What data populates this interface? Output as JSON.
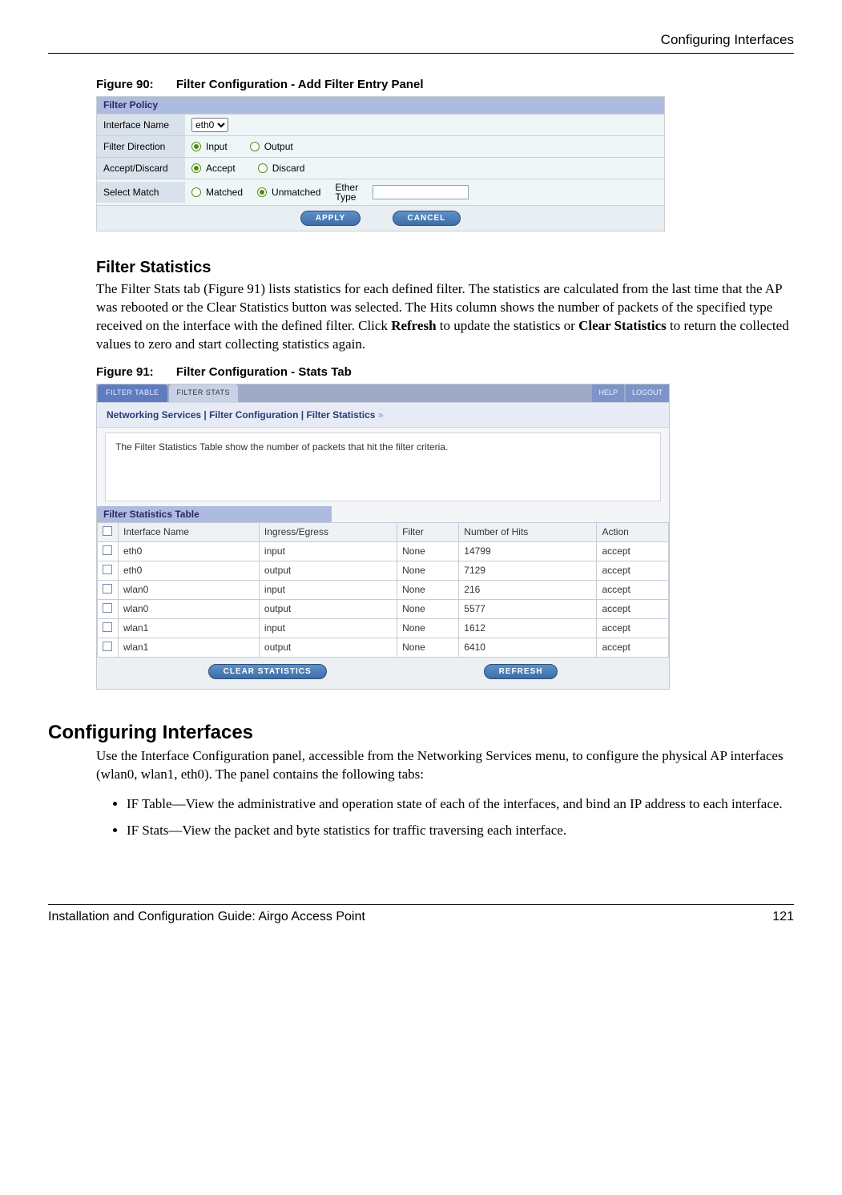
{
  "header": {
    "right": "Configuring Interfaces"
  },
  "figure90": {
    "caption_no": "Figure 90:",
    "caption_text": "Filter Configuration - Add Filter Entry Panel",
    "panel_title": "Filter Policy",
    "rows": {
      "interface_label": "Interface Name",
      "interface_value": "eth0",
      "direction_label": "Filter Direction",
      "direction_options": {
        "input": "Input",
        "output": "Output"
      },
      "accept_label": "Accept/Discard",
      "accept_options": {
        "accept": "Accept",
        "discard": "Discard"
      },
      "match_label": "Select Match",
      "match_options": {
        "matched": "Matched",
        "unmatched": "Unmatched"
      },
      "ether_label_1": "Ether",
      "ether_label_2": "Type"
    },
    "buttons": {
      "apply": "APPLY",
      "cancel": "CANCEL"
    }
  },
  "section_filter_stats": {
    "heading": "Filter Statistics",
    "body_pre": "The Filter Stats tab (Figure 91) lists statistics for each defined filter. The statistics are calculated from the last time that the AP was rebooted or the Clear Statistics button was selected. The Hits column shows the number of packets of the specified type received on the interface with the defined filter. Click ",
    "bold1": "Refresh",
    "body_mid": " to update the statistics or ",
    "bold2": "Clear Statistics",
    "body_post": " to return the collected values to zero and start collecting statistics again."
  },
  "figure91": {
    "caption_no": "Figure 91:",
    "caption_text": "Filter Configuration - Stats Tab",
    "tabs": {
      "filter_table": "FILTER TABLE",
      "filter_stats": "FILTER STATS",
      "help": "HELP",
      "logout": "LOGOUT"
    },
    "breadcrumb": {
      "a": "Networking Services",
      "b": "Filter Configuration",
      "c": "Filter Statistics"
    },
    "desc": "The Filter Statistics Table show the number of packets that hit the filter criteria.",
    "stats_title": "Filter Statistics Table",
    "columns": {
      "c1": "Interface Name",
      "c2": "Ingress/Egress",
      "c3": "Filter",
      "c4": "Number of Hits",
      "c5": "Action"
    },
    "rows": [
      {
        "iface": "eth0",
        "dir": "input",
        "filter": "None",
        "hits": "14799",
        "action": "accept"
      },
      {
        "iface": "eth0",
        "dir": "output",
        "filter": "None",
        "hits": "7129",
        "action": "accept"
      },
      {
        "iface": "wlan0",
        "dir": "input",
        "filter": "None",
        "hits": "216",
        "action": "accept"
      },
      {
        "iface": "wlan0",
        "dir": "output",
        "filter": "None",
        "hits": "5577",
        "action": "accept"
      },
      {
        "iface": "wlan1",
        "dir": "input",
        "filter": "None",
        "hits": "1612",
        "action": "accept"
      },
      {
        "iface": "wlan1",
        "dir": "output",
        "filter": "None",
        "hits": "6410",
        "action": "accept"
      }
    ],
    "buttons": {
      "clear": "CLEAR STATISTICS",
      "refresh": "REFRESH"
    }
  },
  "section_conf_if": {
    "heading": "Configuring Interfaces",
    "body": "Use the Interface Configuration panel, accessible from the Networking Services menu, to configure the physical AP interfaces (wlan0, wlan1, eth0). The panel contains the following tabs:",
    "bullets": [
      "IF Table—View the administrative and operation state of each of the interfaces, and bind an IP address to each interface.",
      "IF Stats—View the packet and byte statistics for traffic traversing each interface."
    ]
  },
  "footer": {
    "left": "Installation and Configuration Guide: Airgo Access Point",
    "right": "121"
  }
}
